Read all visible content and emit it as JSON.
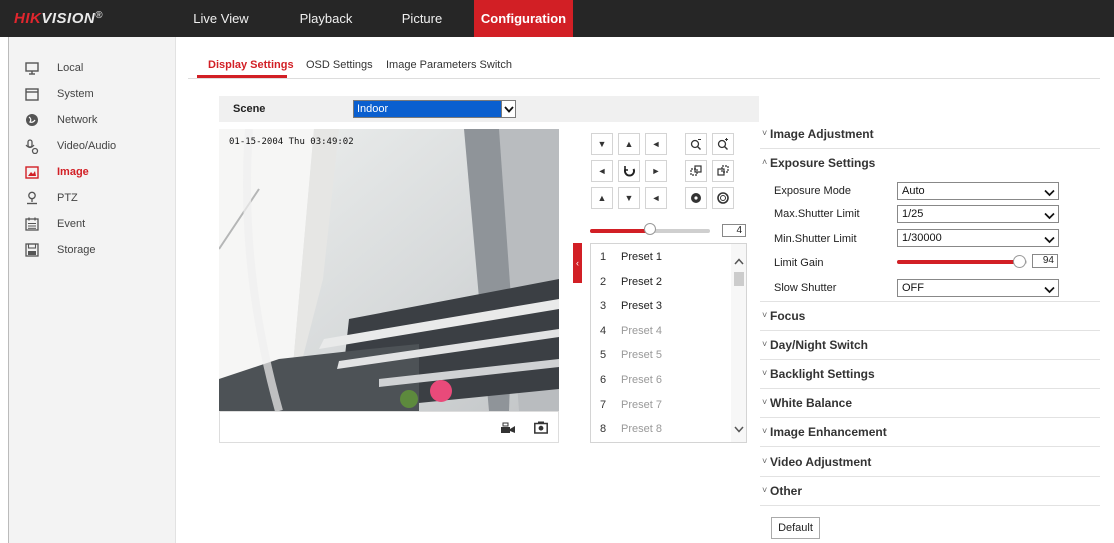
{
  "header": {
    "logo": {
      "brand_red": "HIK",
      "brand_white": "VISION",
      "reg": "®"
    },
    "nav": [
      "Live View",
      "Playback",
      "Picture",
      "Configuration"
    ],
    "active_nav": "Configuration"
  },
  "sidebar": {
    "items": [
      {
        "label": "Local",
        "icon": "monitor-icon"
      },
      {
        "label": "System",
        "icon": "system-icon"
      },
      {
        "label": "Network",
        "icon": "globe-icon"
      },
      {
        "label": "Video/Audio",
        "icon": "video-audio-icon"
      },
      {
        "label": "Image",
        "icon": "image-icon"
      },
      {
        "label": "PTZ",
        "icon": "ptz-icon"
      },
      {
        "label": "Event",
        "icon": "calendar-icon"
      },
      {
        "label": "Storage",
        "icon": "storage-icon"
      }
    ],
    "active": "Image"
  },
  "tabs": [
    "Display Settings",
    "OSD Settings",
    "Image Parameters Switch"
  ],
  "scene": {
    "label": "Scene",
    "value": "Indoor"
  },
  "video": {
    "osd_time": "01-15-2004 Thu 03:49:02"
  },
  "ptz": {
    "speed_value": "4",
    "speed_fraction": 0.5
  },
  "presets": [
    {
      "num": "1",
      "name": "Preset 1",
      "set": true
    },
    {
      "num": "2",
      "name": "Preset 2",
      "set": true
    },
    {
      "num": "3",
      "name": "Preset 3",
      "set": true
    },
    {
      "num": "4",
      "name": "Preset 4",
      "set": false
    },
    {
      "num": "5",
      "name": "Preset 5",
      "set": false
    },
    {
      "num": "6",
      "name": "Preset 6",
      "set": false
    },
    {
      "num": "7",
      "name": "Preset 7",
      "set": false
    },
    {
      "num": "8",
      "name": "Preset 8",
      "set": false
    }
  ],
  "sections": {
    "image_adjustment": "Image Adjustment",
    "exposure_settings": "Exposure Settings",
    "focus": "Focus",
    "day_night": "Day/Night Switch",
    "backlight": "Backlight Settings",
    "white_balance": "White Balance",
    "image_enhancement": "Image Enhancement",
    "video_adjustment": "Video Adjustment",
    "other": "Other"
  },
  "exposure": {
    "exposure_mode": {
      "label": "Exposure Mode",
      "value": "Auto"
    },
    "max_shutter": {
      "label": "Max.Shutter Limit",
      "value": "1/25"
    },
    "min_shutter": {
      "label": "Min.Shutter Limit",
      "value": "1/30000"
    },
    "limit_gain": {
      "label": "Limit Gain",
      "value": "94"
    },
    "slow_shutter": {
      "label": "Slow Shutter",
      "value": "OFF"
    }
  },
  "default_button": "Default",
  "colors": {
    "accent": "#d21f25",
    "topbar": "#262626",
    "scene_select": "#0a5fcf"
  }
}
